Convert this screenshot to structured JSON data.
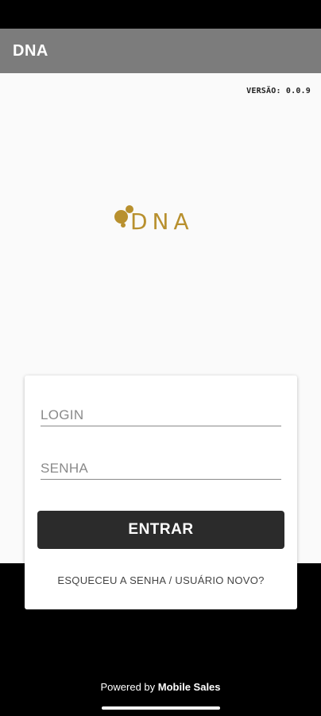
{
  "app": {
    "title": "DNA"
  },
  "version": {
    "text": "VERSÃO: 0.0.9"
  },
  "logo": {
    "wordmark": "DNA",
    "brand_color": "#b8902e"
  },
  "login_form": {
    "login_placeholder": "LOGIN",
    "senha_placeholder": "SENHA",
    "login_value": "",
    "senha_value": "",
    "submit_label": "ENTRAR",
    "forgot_label": "ESQUECEU A SENHA / USUÁRIO NOVO?"
  },
  "footer": {
    "powered_prefix": "Powered by",
    "powered_brand": "Mobile Sales"
  },
  "colors": {
    "app_bar": "#7c7c7c",
    "button": "#2b2b2b",
    "background": "#fafafa"
  }
}
